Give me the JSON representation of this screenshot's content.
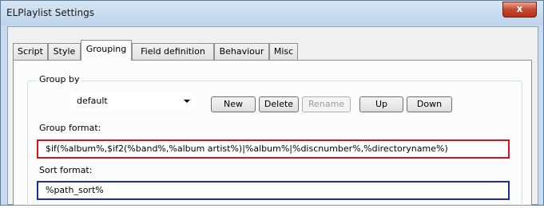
{
  "window": {
    "title": "ELPlaylist Settings",
    "close_label": "x"
  },
  "tabs": [
    {
      "label": "Script"
    },
    {
      "label": "Style"
    },
    {
      "label": "Grouping",
      "active": true
    },
    {
      "label": "Field definition"
    },
    {
      "label": "Behaviour"
    },
    {
      "label": "Misc"
    }
  ],
  "group_by": {
    "label": "Group by",
    "selected": "default",
    "buttons": {
      "new": "New",
      "delete": "Delete",
      "rename": "Rename",
      "up": "Up",
      "down": "Down"
    },
    "rename_disabled": true
  },
  "group_format": {
    "label": "Group format:",
    "value": "$if(%album%,$if2(%band%,%album artist%)|%album%|%discnumber%,%directoryname%)",
    "highlight_color": "#d8141b"
  },
  "sort_format": {
    "label": "Sort format:",
    "value": "%path_sort%",
    "highlight_color": "#1c2ca8"
  }
}
